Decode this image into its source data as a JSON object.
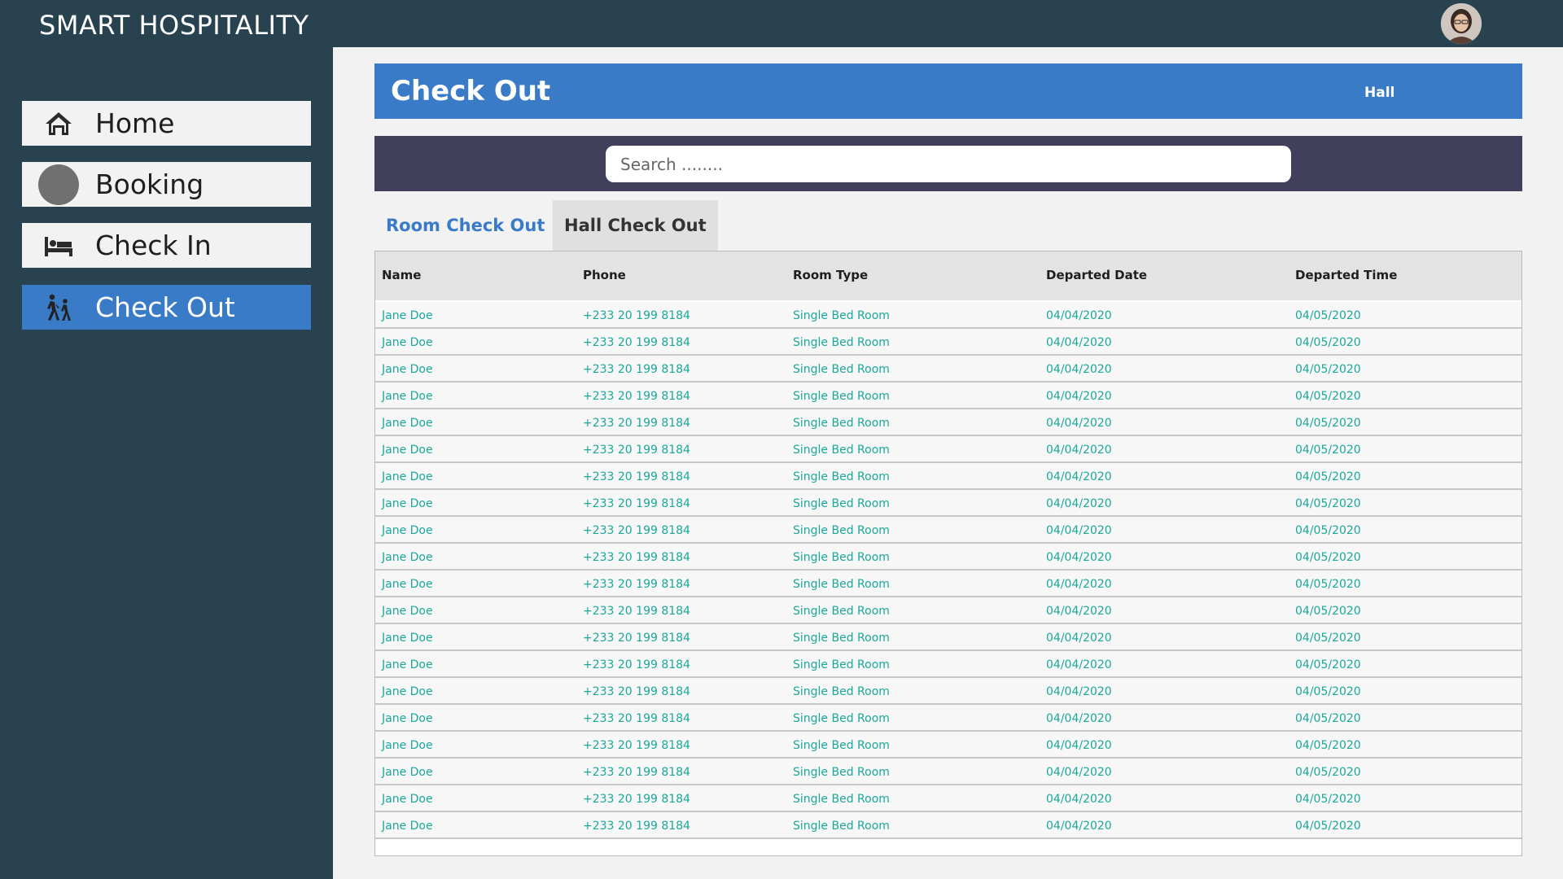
{
  "app": {
    "title": "SMART HOSPITALITY"
  },
  "sidebar": {
    "items": [
      {
        "label": "Home",
        "icon": "home-icon",
        "active": false
      },
      {
        "label": "Booking",
        "icon": "booking-circle-icon",
        "active": false
      },
      {
        "label": "Check In",
        "icon": "bed-icon",
        "active": false
      },
      {
        "label": "Check Out",
        "icon": "walking-people-icon",
        "active": true
      }
    ]
  },
  "header": {
    "title": "Check Out",
    "hall_link": "Hall"
  },
  "search": {
    "placeholder": "Search ........"
  },
  "tabs": [
    {
      "label": "Room Check Out",
      "active": true
    },
    {
      "label": "Hall Check Out",
      "active": false
    }
  ],
  "table": {
    "columns": [
      "Name",
      "Phone",
      "Room Type",
      "Departed Date",
      "Departed Time"
    ],
    "rows": [
      [
        "Jane Doe",
        "+233 20 199 8184",
        "Single Bed Room",
        "04/04/2020",
        "04/05/2020"
      ],
      [
        "Jane Doe",
        "+233 20 199 8184",
        "Single Bed Room",
        "04/04/2020",
        "04/05/2020"
      ],
      [
        "Jane Doe",
        "+233 20 199 8184",
        "Single Bed Room",
        "04/04/2020",
        "04/05/2020"
      ],
      [
        "Jane Doe",
        "+233 20 199 8184",
        "Single Bed Room",
        "04/04/2020",
        "04/05/2020"
      ],
      [
        "Jane Doe",
        "+233 20 199 8184",
        "Single Bed Room",
        "04/04/2020",
        "04/05/2020"
      ],
      [
        "Jane Doe",
        "+233 20 199 8184",
        "Single Bed Room",
        "04/04/2020",
        "04/05/2020"
      ],
      [
        "Jane Doe",
        "+233 20 199 8184",
        "Single Bed Room",
        "04/04/2020",
        "04/05/2020"
      ],
      [
        "Jane Doe",
        "+233 20 199 8184",
        "Single Bed Room",
        "04/04/2020",
        "04/05/2020"
      ],
      [
        "Jane Doe",
        "+233 20 199 8184",
        "Single Bed Room",
        "04/04/2020",
        "04/05/2020"
      ],
      [
        "Jane Doe",
        "+233 20 199 8184",
        "Single Bed Room",
        "04/04/2020",
        "04/05/2020"
      ],
      [
        "Jane Doe",
        "+233 20 199 8184",
        "Single Bed Room",
        "04/04/2020",
        "04/05/2020"
      ],
      [
        "Jane Doe",
        "+233 20 199 8184",
        "Single Bed Room",
        "04/04/2020",
        "04/05/2020"
      ],
      [
        "Jane Doe",
        "+233 20 199 8184",
        "Single Bed Room",
        "04/04/2020",
        "04/05/2020"
      ],
      [
        "Jane Doe",
        "+233 20 199 8184",
        "Single Bed Room",
        "04/04/2020",
        "04/05/2020"
      ],
      [
        "Jane Doe",
        "+233 20 199 8184",
        "Single Bed Room",
        "04/04/2020",
        "04/05/2020"
      ],
      [
        "Jane Doe",
        "+233 20 199 8184",
        "Single Bed Room",
        "04/04/2020",
        "04/05/2020"
      ],
      [
        "Jane Doe",
        "+233 20 199 8184",
        "Single Bed Room",
        "04/04/2020",
        "04/05/2020"
      ],
      [
        "Jane Doe",
        "+233 20 199 8184",
        "Single Bed Room",
        "04/04/2020",
        "04/05/2020"
      ],
      [
        "Jane Doe",
        "+233 20 199 8184",
        "Single Bed Room",
        "04/04/2020",
        "04/05/2020"
      ],
      [
        "Jane Doe",
        "+233 20 199 8184",
        "Single Bed Room",
        "04/04/2020",
        "04/05/2020"
      ]
    ]
  },
  "colors": {
    "topbar": "#28434f",
    "accent": "#3a7bc8",
    "search_band": "#403f5c",
    "cell_text": "#1aa89a"
  }
}
